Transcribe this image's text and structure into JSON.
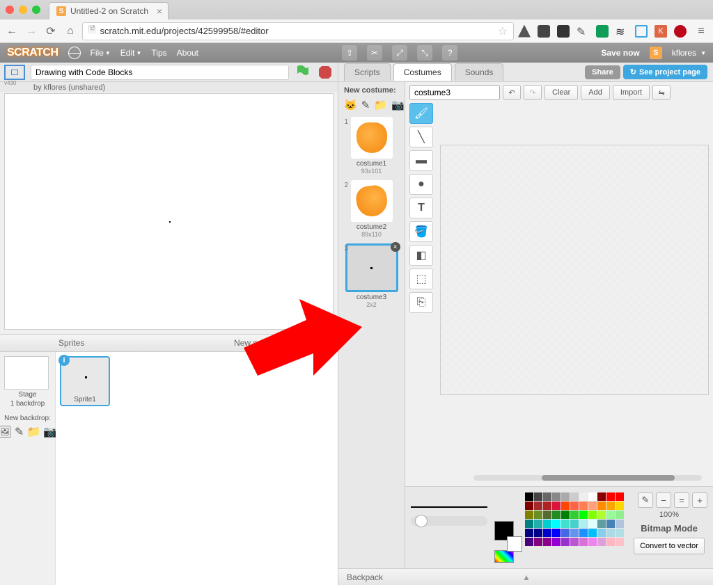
{
  "browser": {
    "tab_title": "Untitled-2 on Scratch",
    "url": "scratch.mit.edu/projects/42599958/#editor"
  },
  "scratch_bar": {
    "logo": "SCRATCH",
    "menus": [
      "File",
      "Edit",
      "Tips",
      "About"
    ],
    "save_now": "Save now",
    "username": "kflores"
  },
  "stage": {
    "version": "v430",
    "title": "Drawing with Code Blocks",
    "byline": "by kflores (unshared)"
  },
  "sprites": {
    "header": "Sprites",
    "new_sprite": "New sprite:",
    "stage_label": "Stage",
    "backdrop_count": "1 backdrop",
    "new_backdrop": "New backdrop:",
    "items": [
      {
        "name": "Sprite1"
      }
    ]
  },
  "right": {
    "tabs": [
      "Scripts",
      "Costumes",
      "Sounds"
    ],
    "active_tab": 1,
    "share": "Share",
    "see_project": "See project page"
  },
  "costumes": {
    "new_label": "New costume:",
    "list": [
      {
        "name": "costume1",
        "dims": "93x101"
      },
      {
        "name": "costume2",
        "dims": "89x110"
      },
      {
        "name": "costume3",
        "dims": "2x2"
      }
    ],
    "selected": 2
  },
  "editor": {
    "costume_name": "costume3",
    "buttons": {
      "clear": "Clear",
      "add": "Add",
      "import": "Import"
    },
    "zoom_pct": "100%",
    "mode_label": "Bitmap Mode",
    "convert": "Convert to vector"
  },
  "backpack": {
    "label": "Backpack"
  }
}
